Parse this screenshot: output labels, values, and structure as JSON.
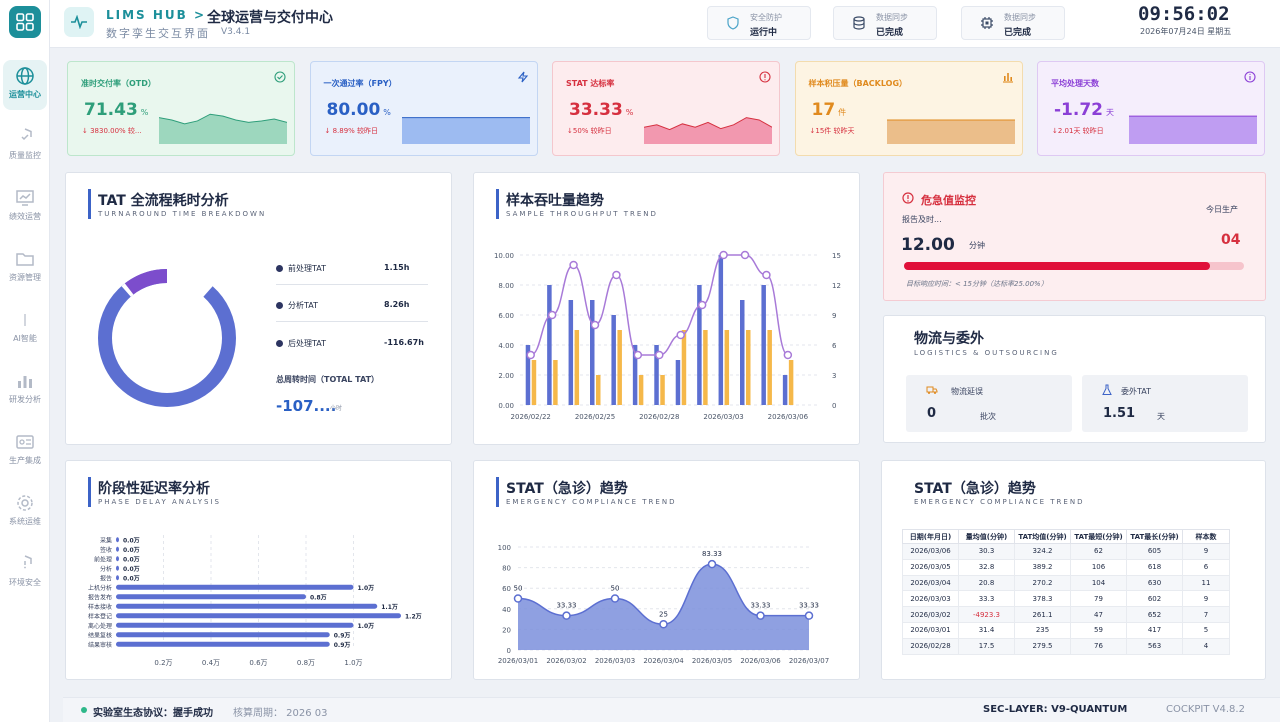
{
  "sidebar": {
    "items": [
      {
        "label": "运营中心",
        "icon": "globe-icon",
        "active": true
      },
      {
        "label": "质量监控",
        "icon": "shield-check-icon"
      },
      {
        "label": "绩效运营",
        "icon": "chart-screen-icon"
      },
      {
        "label": "资源管理",
        "icon": "folder-icon"
      },
      {
        "label": "AI智能",
        "icon": "brain-icon"
      },
      {
        "label": "研发分析",
        "icon": "bar-chart-icon"
      },
      {
        "label": "生产集成",
        "icon": "id-card-icon"
      },
      {
        "label": "系统运维",
        "icon": "gear-icon"
      },
      {
        "label": "环境安全",
        "icon": "shield-alert-icon"
      }
    ]
  },
  "header": {
    "brand": "LIMS HUB  >",
    "title": "全球运营与交付中心",
    "subtitle": "数字孪生交互界面",
    "version": "V3.4.1",
    "statuses": [
      {
        "label": "安全防护",
        "value": "运行中",
        "icon": "shield-icon"
      },
      {
        "label": "数据同步",
        "value": "已完成",
        "icon": "database-icon"
      },
      {
        "label": "数据同步",
        "value": "已完成",
        "icon": "chip-icon"
      }
    ],
    "clock": "09:56:02",
    "date": "2026年07月24日 星期五"
  },
  "kpis": [
    {
      "title": "准时交付率（OTD）",
      "value": "71.43",
      "unit": "%",
      "delta": "↓ 3830.00% 较...",
      "color": "#2e9e7a",
      "bg": "#e9f7ee",
      "border": "#bde6cc",
      "fill": "#8fd1b5",
      "icon": "check-circle-icon",
      "trend": [
        0.55,
        0.5,
        0.42,
        0.48,
        0.62,
        0.58,
        0.5,
        0.45,
        0.48,
        0.52,
        0.45
      ]
    },
    {
      "title": "一次通过率（FPY）",
      "value": "80.00",
      "unit": "%",
      "delta": "↓ 8.89% 较昨日",
      "color": "#2a60c4",
      "bg": "#eaf1fc",
      "border": "#c3d6f3",
      "fill": "#8fb1ee",
      "icon": "bolt-icon",
      "trend": [
        0.55,
        0.55,
        0.55,
        0.55,
        0.55,
        0.55,
        0.55,
        0.55,
        0.55,
        0.55,
        0.55
      ]
    },
    {
      "title": "STAT 达标率",
      "value": "33.33",
      "unit": "%",
      "delta": "↓50% 较昨日",
      "color": "#d6303f",
      "bg": "#fdecee",
      "border": "#f4c7cd",
      "fill": "#f08aa3",
      "icon": "alert-circle-icon",
      "trend": [
        0.35,
        0.4,
        0.3,
        0.42,
        0.35,
        0.45,
        0.32,
        0.4,
        0.55,
        0.5,
        0.35
      ]
    },
    {
      "title": "样本积压量（BACKLOG）",
      "value": "17",
      "unit": "件",
      "delta": "↓15件 较昨天",
      "color": "#e08a1e",
      "bg": "#fdf4e3",
      "border": "#f3dcae",
      "fill": "#e8b47a",
      "icon": "bars-icon",
      "trend": [
        0.5,
        0.5,
        0.5,
        0.5,
        0.5,
        0.5,
        0.5,
        0.5,
        0.5,
        0.5,
        0.5
      ]
    },
    {
      "title": "平均处理天数",
      "value": "-1.72",
      "unit": "天",
      "delta": "↓2.01天 较昨日",
      "color": "#8b3fd6",
      "bg": "#f5eefc",
      "border": "#dec9f3",
      "fill": "#b58ef0",
      "icon": "info-circle-icon",
      "trend": [
        0.58,
        0.58,
        0.58,
        0.58,
        0.58,
        0.58,
        0.58,
        0.58,
        0.58,
        0.58,
        0.58
      ]
    }
  ],
  "tat": {
    "title": "TAT 全流程耗时分析",
    "subtitle": "TURNAROUND TIME BREAKDOWN",
    "legend": [
      {
        "label": "前处理TAT",
        "value": "1.15h"
      },
      {
        "label": "分析TAT",
        "value": "8.26h"
      },
      {
        "label": "后处理TAT",
        "value": "-116.67h"
      }
    ],
    "total_label": "总周转时间（TOTAL TAT）",
    "total_value": "-107....",
    "total_unit": "小时"
  },
  "throughput": {
    "title": "样本吞吐量趋势",
    "subtitle": "SAMPLE THROUGHPUT TREND"
  },
  "critical": {
    "title": "危急值监控",
    "report_label": "报告及时...",
    "report_value": "12.00",
    "report_unit": "分钟",
    "today_label": "今日生产",
    "today_value": "04",
    "target": "目标响应时间：< 15分钟（达标率25.00%）",
    "progress": 0.9
  },
  "logistics": {
    "title": "物流与委外",
    "subtitle": "LOGISTICS & OUTSOURCING",
    "items": [
      {
        "label": "物流延误",
        "value": "0",
        "unit": "批次",
        "icon": "truck-icon"
      },
      {
        "label": "委外TAT",
        "value": "1.51",
        "unit": "天",
        "icon": "flask-icon"
      }
    ]
  },
  "delay": {
    "title": "阶段性延迟率分析",
    "subtitle": "PHASE DELAY ANALYSIS"
  },
  "stat_trend": {
    "title": "STAT（急诊）趋势",
    "subtitle": "EMERGENCY COMPLIANCE TREND"
  },
  "stat_table": {
    "title": "STAT（急诊）趋势",
    "subtitle": "EMERGENCY COMPLIANCE TREND",
    "headers": [
      "日期(年月日)",
      "量均值(分钟)",
      "TAT均值(分钟)",
      "TAT最短(分钟)",
      "TAT最长(分钟)",
      "样本数"
    ],
    "rows": [
      [
        "2026/03/06",
        "30.3",
        "324.2",
        "62",
        "605",
        "9"
      ],
      [
        "2026/03/05",
        "32.8",
        "389.2",
        "106",
        "618",
        "6"
      ],
      [
        "2026/03/04",
        "20.8",
        "270.2",
        "104",
        "630",
        "11"
      ],
      [
        "2026/03/03",
        "33.3",
        "378.3",
        "79",
        "602",
        "9"
      ],
      [
        "2026/03/02",
        "-4923.3",
        "261.1",
        "47",
        "652",
        "7"
      ],
      [
        "2026/03/01",
        "31.4",
        "235",
        "59",
        "417",
        "5"
      ],
      [
        "2026/02/28",
        "17.5",
        "279.5",
        "76",
        "563",
        "4"
      ]
    ]
  },
  "footer": {
    "protocol_label": "实验室生态协议：握手成功",
    "period": "核算周期：  2026 03",
    "sec": "SEC-LAYER:  V9-QUANTUM",
    "cockpit": "COCKPIT  V4.8.2"
  },
  "chart_data": [
    {
      "type": "pie",
      "title": "TAT 全流程耗时分析",
      "categories": [
        "前处理TAT",
        "分析TAT",
        "后处理TAT"
      ],
      "values": [
        1.15,
        8.26,
        -116.67
      ],
      "colors": [
        "#2d3561",
        "#7c4dcc",
        "#5c6fd1"
      ]
    },
    {
      "type": "bar",
      "title": "样本吞吐量趋势",
      "categories": [
        "2026/02/22",
        "",
        "",
        "2026/02/25",
        "",
        "",
        "2026/02/28",
        "",
        "",
        "2026/03/03",
        "",
        "",
        "2026/03/06",
        ""
      ],
      "series": [
        {
          "values": [
            4,
            8,
            7,
            7,
            6,
            4,
            4,
            3,
            8,
            10,
            7,
            8,
            2,
            0
          ],
          "color": "#5c6fd1"
        },
        {
          "values": [
            3,
            3,
            5,
            2,
            5,
            2,
            2,
            5,
            5,
            5,
            5,
            5,
            3,
            0
          ],
          "color": "#f5b84a"
        },
        {
          "values": [
            5,
            9,
            14,
            8,
            13,
            5,
            5,
            7,
            10,
            15,
            15,
            13,
            5,
            0
          ],
          "color": "#a87ad8",
          "type": "line"
        }
      ],
      "ylim": [
        0,
        10
      ],
      "y2lim": [
        0,
        15
      ],
      "yticks": [
        "0.00",
        "2.00",
        "4.00",
        "6.00",
        "8.00",
        "10.00"
      ],
      "y2ticks": [
        "0",
        "3",
        "6",
        "9",
        "12",
        "15"
      ]
    },
    {
      "type": "bar",
      "title": "阶段性延迟率分析",
      "orientation": "horizontal",
      "categories": [
        "采集",
        "签收",
        "前处理",
        "分析",
        "报告",
        "上机分析",
        "报告发布",
        "样本接收",
        "样本登记",
        "离心处理",
        "结果复核",
        "结果审核"
      ],
      "values": [
        0,
        0,
        0,
        0,
        0,
        1.0,
        0.8,
        1.1,
        1.2,
        1.0,
        0.9,
        0.9
      ],
      "labels": [
        "0.0万",
        "0.0万",
        "0.0万",
        "0.0万",
        "0.0万",
        "1.0万",
        "0.8万",
        "1.1万",
        "1.2万",
        "1.0万",
        "0.9万",
        "0.9万"
      ],
      "xticks": [
        "0.2万",
        "0.4万",
        "0.6万",
        "0.8万",
        "1.0万"
      ],
      "xlim": [
        0,
        1.2
      ]
    },
    {
      "type": "area",
      "title": "STAT（急诊）趋势",
      "categories": [
        "2026/03/01",
        "2026/03/02",
        "2026/03/03",
        "2026/03/04",
        "2026/03/05",
        "2026/03/06",
        "2026/03/07"
      ],
      "values": [
        50,
        33.33,
        50,
        25,
        83.33,
        33.33,
        33.33
      ],
      "labels": [
        "50",
        "33.33",
        "50",
        "25",
        "83.33",
        "33.33",
        "33.33"
      ],
      "ylim": [
        0,
        100
      ],
      "yticks": [
        "0",
        "20",
        "40",
        "60",
        "80",
        "100"
      ]
    }
  ]
}
